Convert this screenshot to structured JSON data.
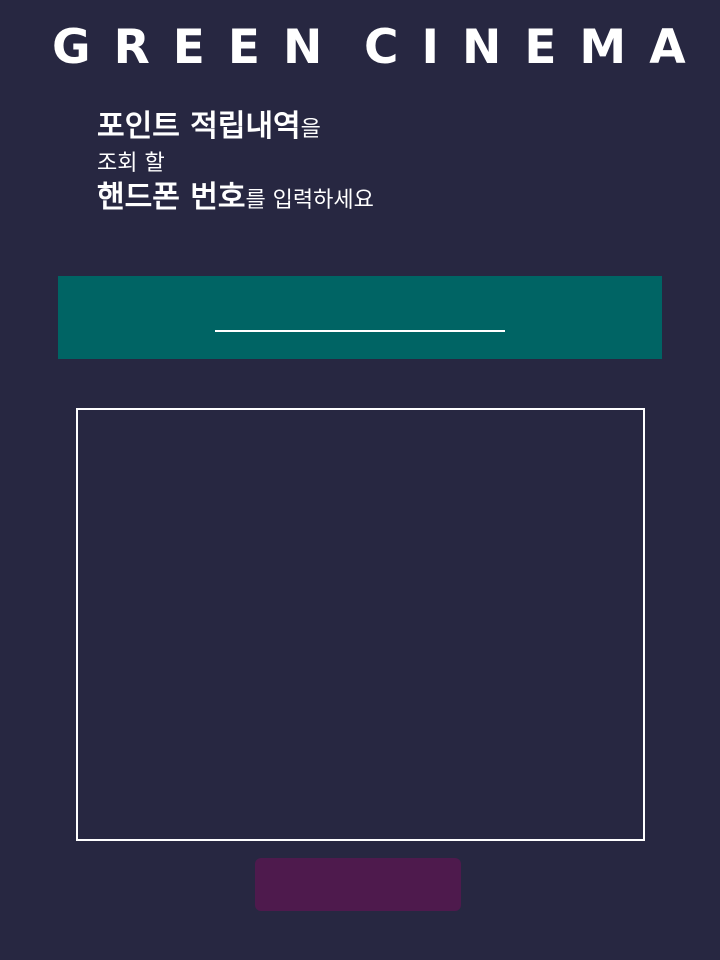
{
  "header": {
    "brand_word_1": "GREEN",
    "brand_word_2": "CINEMA"
  },
  "prompt": {
    "line1_strong": "포인트 적립내역",
    "line1_normal": "을",
    "line2_normal": "조회 할",
    "line3_strong": "핸드폰 번호",
    "line3_normal": "를  입력하세요"
  },
  "phone": {
    "value": "",
    "placeholder": ""
  },
  "submit": {
    "label": ""
  },
  "colors": {
    "background": "#272741",
    "input_bar": "#006464",
    "submit_button": "#4e1a4d",
    "text": "#ffffff"
  }
}
